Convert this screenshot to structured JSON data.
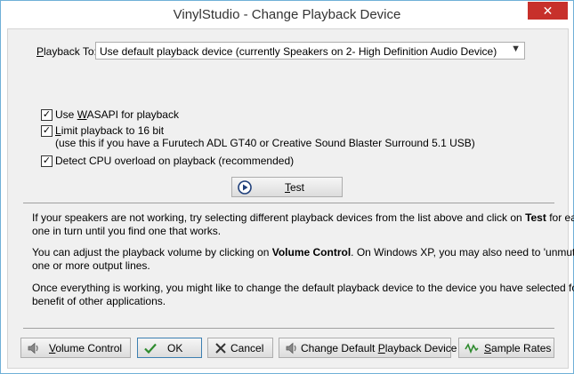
{
  "window": {
    "title": "VinylStudio - Change Playback Device",
    "close_glyph": "✕"
  },
  "playback": {
    "label_pre": "",
    "label_u": "P",
    "label_post": "layback To:",
    "selected": "Use default playback device (currently Speakers on 2- High Definition Audio Device)"
  },
  "options": {
    "wasapi": {
      "checked": true,
      "pre": "Use ",
      "u": "W",
      "post": "ASAPI for playback"
    },
    "limit16": {
      "checked": true,
      "pre": "",
      "u": "L",
      "post": "imit playback to 16 bit",
      "note": "(use this if you have a Furutech ADL GT40 or Creative Sound Blaster Surround 5.1 USB)"
    },
    "cpu": {
      "checked": true,
      "label": "Detect CPU overload on playback (recommended)"
    }
  },
  "test_button": {
    "u": "T",
    "post": "est",
    "icon": "play-icon"
  },
  "info": {
    "p1_line1_pre": "If your speakers are not working, try selecting different playback devices from the list above and click on ",
    "p1_line1_bold": "Test",
    "p1_line1_post": " for each",
    "p1_line2": "one in turn until you find one that works.",
    "p2_line1_pre": "You can adjust the playback volume by clicking on ",
    "p2_line1_bold": "Volume Control",
    "p2_line1_post": ".  On Windows XP, you may also need to 'unmute'",
    "p2_line2": "one or more output lines.",
    "p3_line1": "Once everything is working, you might like to change the default playback device to the device you have selected for the",
    "p3_line2": "benefit of other applications."
  },
  "buttons": {
    "volume": {
      "u": "V",
      "post": "olume Control",
      "icon": "speaker-icon"
    },
    "ok": {
      "label": "OK",
      "icon": "checkmark-icon"
    },
    "cancel": {
      "label": "Cancel",
      "icon": "cross-icon"
    },
    "change_default": {
      "pre": "Change Default ",
      "u": "P",
      "post": "layback Device",
      "icon": "speaker-icon"
    },
    "sample_rates": {
      "u": "S",
      "post": "ample Rates",
      "icon": "wave-icon"
    }
  }
}
